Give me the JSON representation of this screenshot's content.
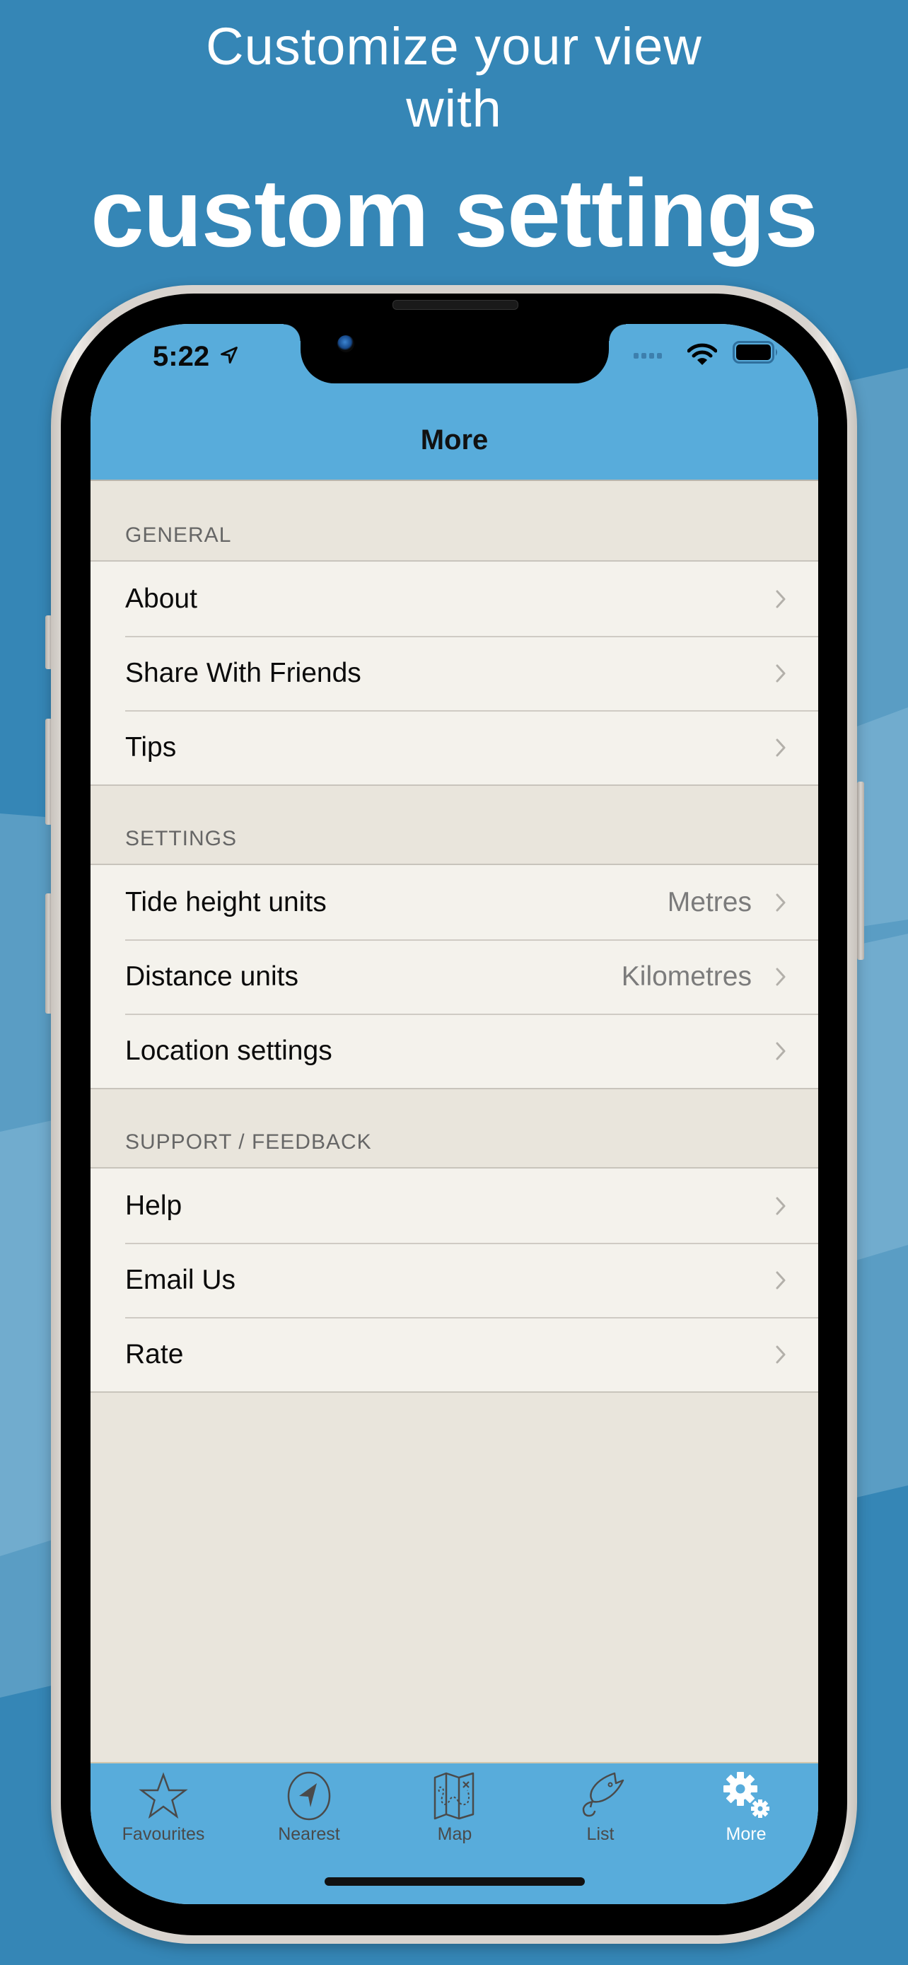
{
  "headline": {
    "line1": "Customize your view",
    "line1b": "with",
    "line2": "custom settings"
  },
  "status_bar": {
    "time": "5:22",
    "location_icon": "location-arrow-icon",
    "signal_icon": "signal-no-service-icon",
    "wifi_icon": "wifi-icon",
    "battery_icon": "battery-full-icon"
  },
  "nav": {
    "title": "More"
  },
  "sections": [
    {
      "header": "GENERAL",
      "rows": [
        {
          "label": "About",
          "value": ""
        },
        {
          "label": "Share With Friends",
          "value": ""
        },
        {
          "label": "Tips",
          "value": ""
        }
      ]
    },
    {
      "header": "SETTINGS",
      "rows": [
        {
          "label": "Tide height units",
          "value": "Metres"
        },
        {
          "label": "Distance units",
          "value": "Kilometres"
        },
        {
          "label": "Location settings",
          "value": ""
        }
      ]
    },
    {
      "header": "SUPPORT / FEEDBACK",
      "rows": [
        {
          "label": "Help",
          "value": ""
        },
        {
          "label": "Email Us",
          "value": ""
        },
        {
          "label": "Rate",
          "value": ""
        }
      ]
    }
  ],
  "tabbar": {
    "active": "More",
    "tabs": [
      {
        "label": "Favourites",
        "icon": "star-icon"
      },
      {
        "label": "Nearest",
        "icon": "compass-arrow-icon"
      },
      {
        "label": "Map",
        "icon": "folded-map-icon"
      },
      {
        "label": "List",
        "icon": "fishing-lure-icon"
      },
      {
        "label": "More",
        "icon": "gears-icon"
      }
    ]
  },
  "colors": {
    "background": "#3586b6",
    "bar_blue": "#58acdb",
    "list_bg": "#f4f2ec",
    "grouped_bg": "#e9e5dc",
    "active_tab": "#ffffff",
    "inactive_tab": "#4a4a4a"
  }
}
